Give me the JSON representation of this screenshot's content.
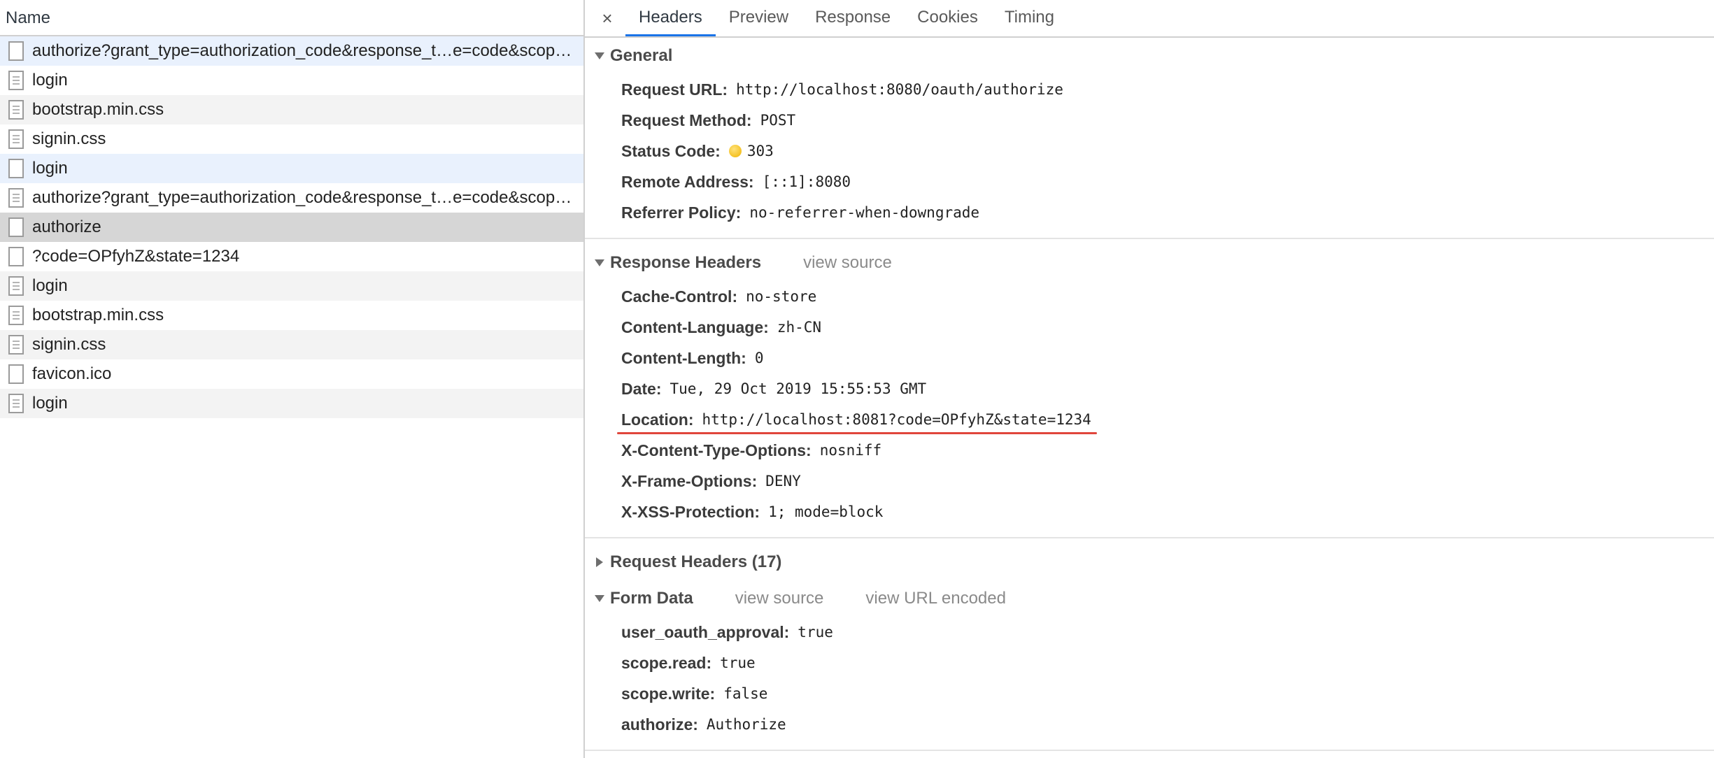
{
  "left": {
    "header": "Name",
    "requests": [
      {
        "name": "authorize?grant_type=authorization_code&response_t…e=code&scop…",
        "icon": "blank",
        "style": "hl"
      },
      {
        "name": "login",
        "icon": "doc",
        "style": ""
      },
      {
        "name": "bootstrap.min.css",
        "icon": "doc",
        "style": "striped"
      },
      {
        "name": "signin.css",
        "icon": "doc",
        "style": ""
      },
      {
        "name": "login",
        "icon": "blank",
        "style": "hl"
      },
      {
        "name": "authorize?grant_type=authorization_code&response_t…e=code&scop…",
        "icon": "doc",
        "style": ""
      },
      {
        "name": "authorize",
        "icon": "blank",
        "style": "selected"
      },
      {
        "name": "?code=OPfyhZ&state=1234",
        "icon": "blank",
        "style": ""
      },
      {
        "name": "login",
        "icon": "doc",
        "style": "striped"
      },
      {
        "name": "bootstrap.min.css",
        "icon": "doc",
        "style": ""
      },
      {
        "name": "signin.css",
        "icon": "doc",
        "style": "striped"
      },
      {
        "name": "favicon.ico",
        "icon": "blank",
        "style": ""
      },
      {
        "name": "login",
        "icon": "doc",
        "style": "striped"
      }
    ]
  },
  "tabs": {
    "close": "×",
    "items": [
      "Headers",
      "Preview",
      "Response",
      "Cookies",
      "Timing"
    ],
    "active": "Headers"
  },
  "general": {
    "title": "General",
    "rows": [
      {
        "key": "Request URL:",
        "value": "http://localhost:8080/oauth/authorize"
      },
      {
        "key": "Request Method:",
        "value": "POST"
      },
      {
        "key": "Status Code:",
        "value": "303"
      },
      {
        "key": "Remote Address:",
        "value": "[::1]:8080"
      },
      {
        "key": "Referrer Policy:",
        "value": "no-referrer-when-downgrade"
      }
    ]
  },
  "response_headers": {
    "title": "Response Headers",
    "view_source": "view source",
    "rows": [
      {
        "key": "Cache-Control:",
        "value": "no-store"
      },
      {
        "key": "Content-Language:",
        "value": "zh-CN"
      },
      {
        "key": "Content-Length:",
        "value": "0"
      },
      {
        "key": "Date:",
        "value": "Tue, 29 Oct 2019 15:55:53 GMT"
      },
      {
        "key": "Location:",
        "value": "http://localhost:8081?code=OPfyhZ&state=1234"
      },
      {
        "key": "X-Content-Type-Options:",
        "value": "nosniff"
      },
      {
        "key": "X-Frame-Options:",
        "value": "DENY"
      },
      {
        "key": "X-XSS-Protection:",
        "value": "1; mode=block"
      }
    ]
  },
  "request_headers": {
    "title": "Request Headers (17)"
  },
  "form_data": {
    "title": "Form Data",
    "view_source": "view source",
    "view_url_encoded": "view URL encoded",
    "rows": [
      {
        "key": "user_oauth_approval:",
        "value": "true"
      },
      {
        "key": "scope.read:",
        "value": "true"
      },
      {
        "key": "scope.write:",
        "value": "false"
      },
      {
        "key": "authorize:",
        "value": "Authorize"
      }
    ]
  },
  "colors": {
    "active_tab_underline": "#1a73e8",
    "highlight_row": "#e9f1fd",
    "selected_row": "#d6d6d6",
    "status_dot": "#f0b400",
    "annotation_underline": "#e0463c"
  }
}
